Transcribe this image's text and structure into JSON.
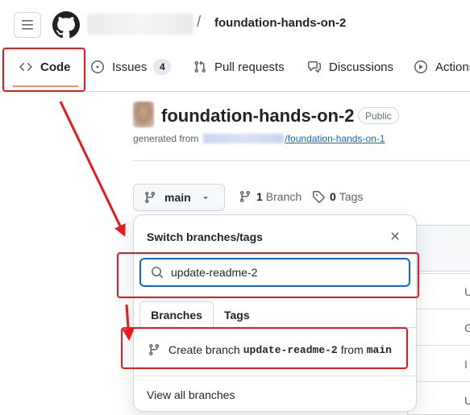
{
  "header": {
    "repo_name": "foundation-hands-on-2",
    "separator": "/"
  },
  "nav": {
    "tabs": [
      {
        "label": "Code",
        "icon": "code-icon",
        "selected": true
      },
      {
        "label": "Issues",
        "icon": "issue-opened-icon",
        "count": "4"
      },
      {
        "label": "Pull requests",
        "icon": "git-pull-request-icon"
      },
      {
        "label": "Discussions",
        "icon": "comment-discussion-icon"
      },
      {
        "label": "Actions",
        "icon": "play-icon"
      }
    ]
  },
  "repo": {
    "title": "foundation-hands-on-2",
    "visibility": "Public",
    "generated_from_label": "generated from",
    "template_repo": "/foundation-hands-on-1"
  },
  "branch_bar": {
    "current_branch": "main",
    "branch_count": "1",
    "branch_label": "Branch",
    "tag_count": "0",
    "tag_label": "Tags"
  },
  "dropdown": {
    "title": "Switch branches/tags",
    "search_value": "update-readme-2",
    "tabs": [
      "Branches",
      "Tags"
    ],
    "create_prefix": "Create branch",
    "create_branch_name": "update-readme-2",
    "create_from_label": "from",
    "create_source_branch": "main",
    "view_all_label": "View all branches"
  },
  "background_rows": [
    "U",
    "C",
    "I",
    "U"
  ],
  "colors": {
    "annotation_red": "#e8191d",
    "link_blue": "#0969da",
    "nav_underline": "#fd8c73"
  }
}
